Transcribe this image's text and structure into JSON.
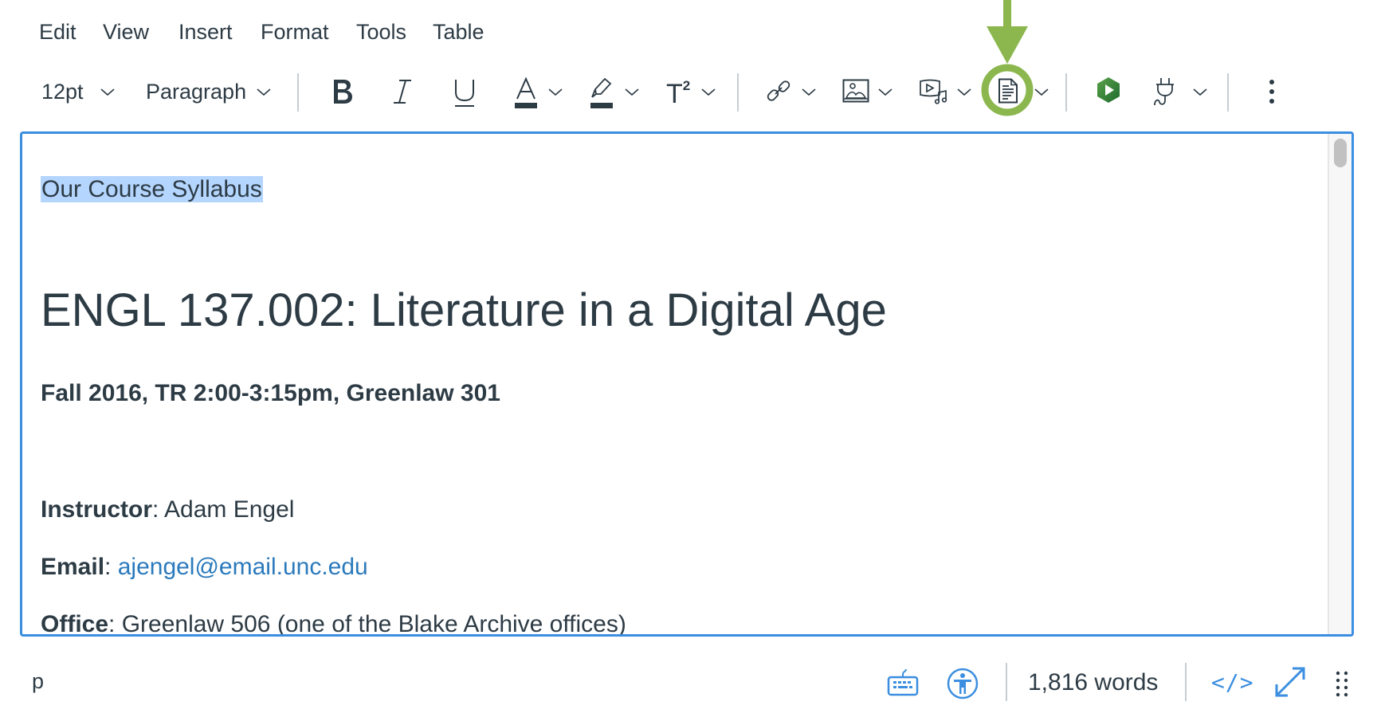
{
  "menubar": {
    "items": [
      {
        "label": "Edit"
      },
      {
        "label": "View"
      },
      {
        "label": "Insert"
      },
      {
        "label": "Format"
      },
      {
        "label": "Tools"
      },
      {
        "label": "Table"
      }
    ]
  },
  "toolbar": {
    "font_size": "12pt",
    "block_format": "Paragraph",
    "superscript_label": "T",
    "superscript_exp": "2",
    "icons": [
      "bold-icon",
      "italic-icon",
      "underline-icon",
      "text-color-icon",
      "highlight-color-icon",
      "superscript-icon",
      "link-icon",
      "image-icon",
      "media-icon",
      "document-icon",
      "panopto-icon",
      "plugin-icon",
      "more-options-icon"
    ]
  },
  "annotation": {
    "color": "#8bb74e",
    "target": "document-icon"
  },
  "editor": {
    "selected_label": "Our Course Syllabus",
    "heading": "ENGL 137.002: Literature in a Digital Age",
    "subtitle": "Fall 2016, TR 2:00-3:15pm, Greenlaw 301",
    "instructor_label": "Instructor",
    "instructor_value": ": Adam Engel",
    "email_label": "Email",
    "email_sep": ": ",
    "email_value": "ajengel@email.unc.edu",
    "office_label": "Office",
    "office_value": ": Greenlaw 506 (one of the Blake Archive offices)"
  },
  "statusbar": {
    "element_path": "p",
    "word_count": "1,816 words",
    "html_editor_label": "</>",
    "icons": [
      "keyboard-icon",
      "accessibility-icon",
      "html-editor-icon",
      "fullscreen-icon",
      "resize-handle-icon"
    ]
  },
  "colors": {
    "accent": "#3b8ee0",
    "text": "#2d3b45",
    "link": "#2b7abc",
    "selection": "#b4d5fe"
  }
}
